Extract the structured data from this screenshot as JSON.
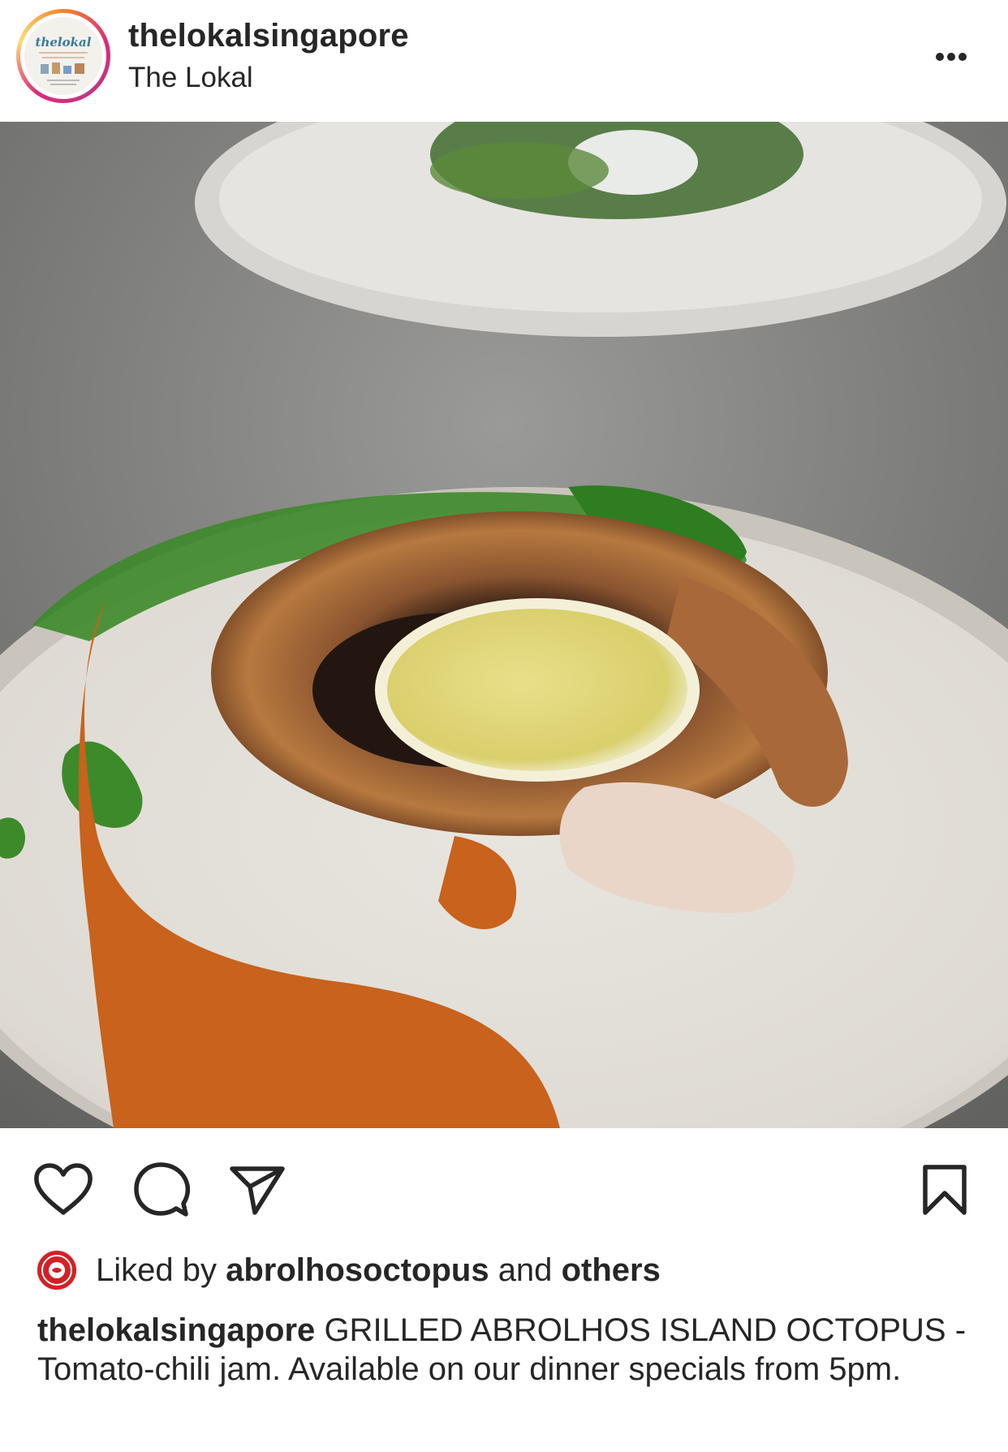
{
  "header": {
    "username": "thelokalsingapore",
    "subtitle": "The Lokal",
    "avatar_logo_text": "thelokal"
  },
  "photo": {
    "description_icon": "food-photo-grilled-octopus"
  },
  "actions": {
    "like_icon": "heart-icon",
    "comment_icon": "comment-icon",
    "share_icon": "send-icon",
    "save_icon": "bookmark-icon"
  },
  "likes": {
    "prefix": "Liked by",
    "liker": "abrolhosoctopus",
    "connector": "and",
    "suffix": "others"
  },
  "caption": {
    "username": "thelokalsingapore",
    "text": "GRILLED ABROLHOS ISLAND OCTOPUS - Tomato-chili jam. Available on our dinner specials from 5pm."
  },
  "colors": {
    "text": "#262626",
    "story_ring_start": "#f58529",
    "story_ring_end": "#dd2a7b"
  }
}
